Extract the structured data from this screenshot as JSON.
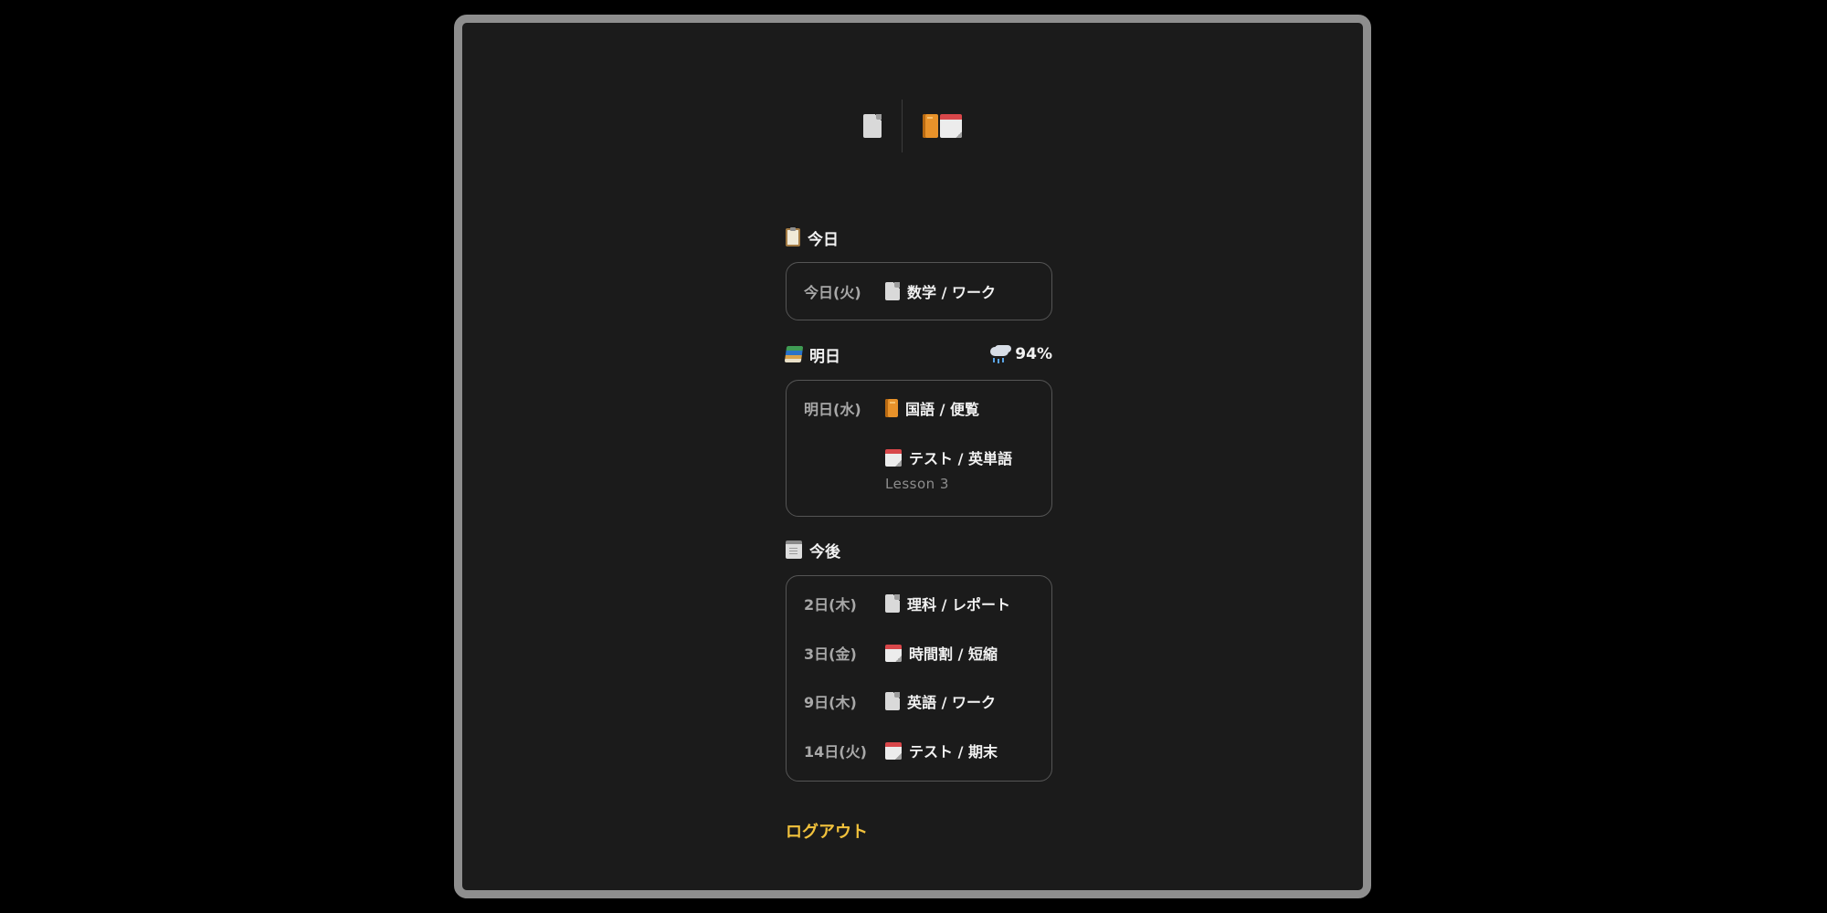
{
  "toolbar": {
    "left_button": {
      "icon": "page-icon"
    },
    "right_button": {
      "icons": [
        "book-icon",
        "calendar-icon"
      ]
    }
  },
  "today": {
    "icon": "clipboard-icon",
    "title": "今日",
    "items": [
      {
        "date": "今日(火)",
        "icon": "page-icon",
        "text": "数学 / ワーク"
      }
    ]
  },
  "tomorrow": {
    "icon": "books-icon",
    "title": "明日",
    "weather": {
      "icon": "rain-cloud-icon",
      "text": "94%"
    },
    "date": "明日(水)",
    "items": [
      {
        "icon": "book-icon",
        "text": "国語 / 便覧"
      },
      {
        "icon": "calendar-icon",
        "text": "テスト / 英単語",
        "note": "Lesson 3"
      }
    ]
  },
  "upcoming": {
    "icon": "notepad-icon",
    "title": "今後",
    "items": [
      {
        "date": "2日(木)",
        "icon": "page-icon",
        "text": "理科 / レポート"
      },
      {
        "date": "3日(金)",
        "icon": "calendar-icon",
        "text": "時間割 / 短縮"
      },
      {
        "date": "9日(木)",
        "icon": "page-icon",
        "text": "英語 / ワーク"
      },
      {
        "date": "14日(火)",
        "icon": "calendar-icon",
        "text": "テスト / 期末"
      }
    ]
  },
  "logout_label": "ログアウト",
  "colors": {
    "background": "#000000",
    "panel": "#1b1b1b",
    "frame": "#8e8e8e",
    "text": "#f2f2f2",
    "muted": "#a8a8a8",
    "accent": "#f2c23c",
    "card_border": "#555555"
  }
}
